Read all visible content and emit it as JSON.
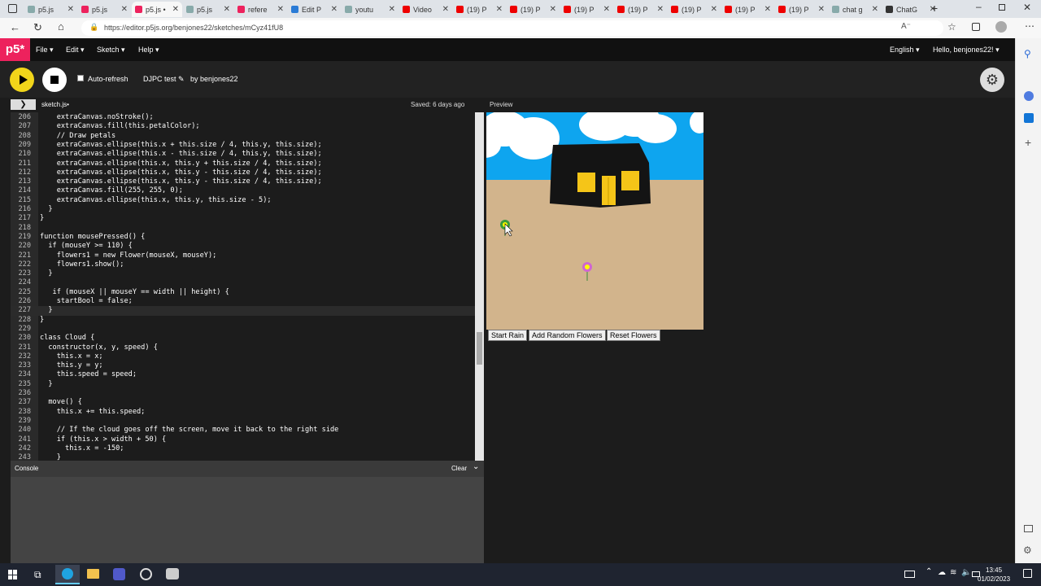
{
  "browser": {
    "tabs": [
      {
        "label": "p5.js",
        "icon": "search-icon",
        "color": "#8aa"
      },
      {
        "label": "p5.js",
        "icon": "p5-icon",
        "color": "#ed225d"
      },
      {
        "label": "p5.js •",
        "icon": "p5-icon",
        "color": "#ed225d",
        "active": true
      },
      {
        "label": "p5.js",
        "icon": "search-icon",
        "color": "#8aa"
      },
      {
        "label": "refere",
        "icon": "p5-icon",
        "color": "#ed225d"
      },
      {
        "label": "Edit P",
        "icon": "globe-icon",
        "color": "#2a7bd6"
      },
      {
        "label": "youtu",
        "icon": "search-icon",
        "color": "#8aa"
      },
      {
        "label": "Video",
        "icon": "youtube-icon",
        "color": "#e00"
      },
      {
        "label": "(19) P",
        "icon": "youtube-icon",
        "color": "#e00"
      },
      {
        "label": "(19) P",
        "icon": "youtube-icon",
        "color": "#e00"
      },
      {
        "label": "(19) P",
        "icon": "youtube-icon",
        "color": "#e00"
      },
      {
        "label": "(19) P",
        "icon": "youtube-icon",
        "color": "#e00"
      },
      {
        "label": "(19) P",
        "icon": "youtube-icon",
        "color": "#e00"
      },
      {
        "label": "(19) P",
        "icon": "youtube-icon",
        "color": "#e00"
      },
      {
        "label": "(19) P",
        "icon": "youtube-icon",
        "color": "#e00"
      },
      {
        "label": "chat g",
        "icon": "search-icon",
        "color": "#8aa"
      },
      {
        "label": "ChatG",
        "icon": "chatgpt-icon",
        "color": "#333"
      }
    ],
    "url": "https://editor.p5js.org/benjones22/sketches/mCyz41fU8"
  },
  "p5nav": {
    "logo": "p5*",
    "menus": [
      "File",
      "Edit",
      "Sketch",
      "Help"
    ],
    "language": "English",
    "user": "Hello, benjones22!"
  },
  "toolbar": {
    "auto_refresh": "Auto-refresh",
    "sketch_name": "DJPC test",
    "by": "by benjones22"
  },
  "editor": {
    "filename": "sketch.js•",
    "saved": "Saved: 6 days ago",
    "preview_label": "Preview",
    "highlighted_line": 227,
    "lines": [
      {
        "n": "206",
        "t": "    extraCanvas.noStroke();"
      },
      {
        "n": "207",
        "t": "    extraCanvas.fill(this.petalColor);"
      },
      {
        "n": "208",
        "t": "    // Draw petals"
      },
      {
        "n": "209",
        "t": "    extraCanvas.ellipse(this.x + this.size / 4, this.y, this.size);"
      },
      {
        "n": "210",
        "t": "    extraCanvas.ellipse(this.x - this.size / 4, this.y, this.size);"
      },
      {
        "n": "211",
        "t": "    extraCanvas.ellipse(this.x, this.y + this.size / 4, this.size);"
      },
      {
        "n": "212",
        "t": "    extraCanvas.ellipse(this.x, this.y - this.size / 4, this.size);"
      },
      {
        "n": "213",
        "t": "    extraCanvas.ellipse(this.x, this.y - this.size / 4, this.size);"
      },
      {
        "n": "214",
        "t": "    extraCanvas.fill(255, 255, 0);"
      },
      {
        "n": "215",
        "t": "    extraCanvas.ellipse(this.x, this.y, this.size - 5);"
      },
      {
        "n": "216",
        "t": "  }"
      },
      {
        "n": "217",
        "t": "}"
      },
      {
        "n": "218",
        "t": ""
      },
      {
        "n": "219",
        "t": "function mousePressed() {"
      },
      {
        "n": "220",
        "t": "  if (mouseY >= 110) {"
      },
      {
        "n": "221",
        "t": "    flowers1 = new Flower(mouseX, mouseY);"
      },
      {
        "n": "222",
        "t": "    flowers1.show();"
      },
      {
        "n": "223",
        "t": "  }"
      },
      {
        "n": "224",
        "t": ""
      },
      {
        "n": "225",
        "t": "   if (mouseX || mouseY == width || height) {"
      },
      {
        "n": "226",
        "t": "    startBool = false;"
      },
      {
        "n": "227",
        "t": "  }"
      },
      {
        "n": "228",
        "t": "}"
      },
      {
        "n": "229",
        "t": ""
      },
      {
        "n": "230",
        "t": "class Cloud {"
      },
      {
        "n": "231",
        "t": "  constructor(x, y, speed) {"
      },
      {
        "n": "232",
        "t": "    this.x = x;"
      },
      {
        "n": "233",
        "t": "    this.y = y;"
      },
      {
        "n": "234",
        "t": "    this.speed = speed;"
      },
      {
        "n": "235",
        "t": "  }"
      },
      {
        "n": "236",
        "t": ""
      },
      {
        "n": "237",
        "t": "  move() {"
      },
      {
        "n": "238",
        "t": "    this.x += this.speed;"
      },
      {
        "n": "239",
        "t": ""
      },
      {
        "n": "240",
        "t": "    // If the cloud goes off the screen, move it back to the right side"
      },
      {
        "n": "241",
        "t": "    if (this.x > width + 50) {"
      },
      {
        "n": "242",
        "t": "      this.x = -150;"
      },
      {
        "n": "243",
        "t": "    }"
      }
    ]
  },
  "console": {
    "title": "Console",
    "clear": "Clear"
  },
  "preview_buttons": [
    "Start Rain",
    "Add Random Flowers",
    "Reset Flowers"
  ],
  "colors": {
    "sky": "#0ea5ef",
    "ground": "#d2b48c",
    "house": "#111111",
    "window": "#f5c518",
    "p5_pink": "#ed225d",
    "play_yellow": "#f1d51a"
  },
  "taskbar": {
    "time": "13:45",
    "date": "01/02/2023"
  }
}
